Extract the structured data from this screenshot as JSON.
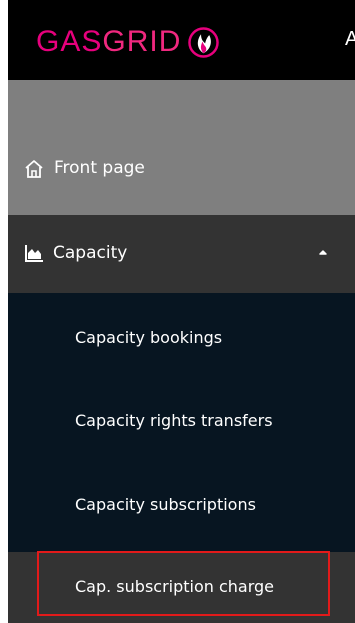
{
  "logo": {
    "gas": "GAS",
    "grid": "GRID"
  },
  "topbar": {
    "cut_text": "A"
  },
  "nav": {
    "front_page": {
      "label": "Front page",
      "icon": "home-icon"
    },
    "capacity": {
      "label": "Capacity",
      "icon": "area-chart-icon",
      "expanded": true,
      "chevron": "chevron-up-icon",
      "children": [
        {
          "label": "Capacity bookings"
        },
        {
          "label": "Capacity rights transfers"
        },
        {
          "label": "Capacity subscriptions"
        },
        {
          "label": "Cap. subscription charge",
          "highlighted": true
        }
      ]
    }
  },
  "colors": {
    "brand": "#e7007d",
    "sidebar_bg": "#071521",
    "header_bg": "#000000",
    "front_band": "#7f7f7f",
    "active_item": "#333333",
    "highlight_border": "#e21a1a"
  }
}
